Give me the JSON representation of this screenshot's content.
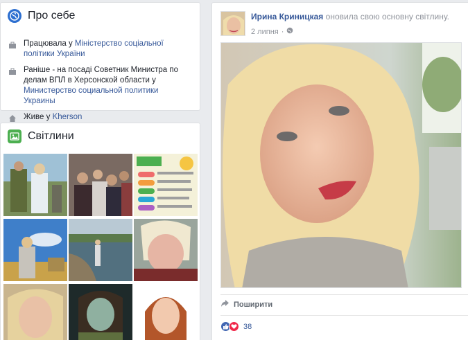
{
  "intro": {
    "title": "Про себе",
    "rows": [
      {
        "prefix": "Працювала у ",
        "link": "Міністерство соціальної політики України",
        "link2": "",
        "suffix": ""
      },
      {
        "prefix": "Раніше - на посаді Советник Министра по делам ВПЛ в Херсонской области у ",
        "link": "Министерство социальной политики Украины",
        "link2": "",
        "suffix": ""
      },
      {
        "prefix": "Живе у ",
        "link": "Kherson",
        "link2": "",
        "suffix": ""
      }
    ]
  },
  "photos": {
    "title": "Світлини"
  },
  "post": {
    "author": "Ирина Криницкая",
    "action": " оновила свою основну світлину.",
    "date": "2 липня",
    "date_separator": "·",
    "share_label": "Поширити",
    "reaction_count": "38"
  },
  "colors": {
    "link": "#365899",
    "like_blue": "#4267b2",
    "love_red": "#f0284a",
    "intro_icon": "#2d6fd0",
    "photos_icon": "#4caf50"
  }
}
